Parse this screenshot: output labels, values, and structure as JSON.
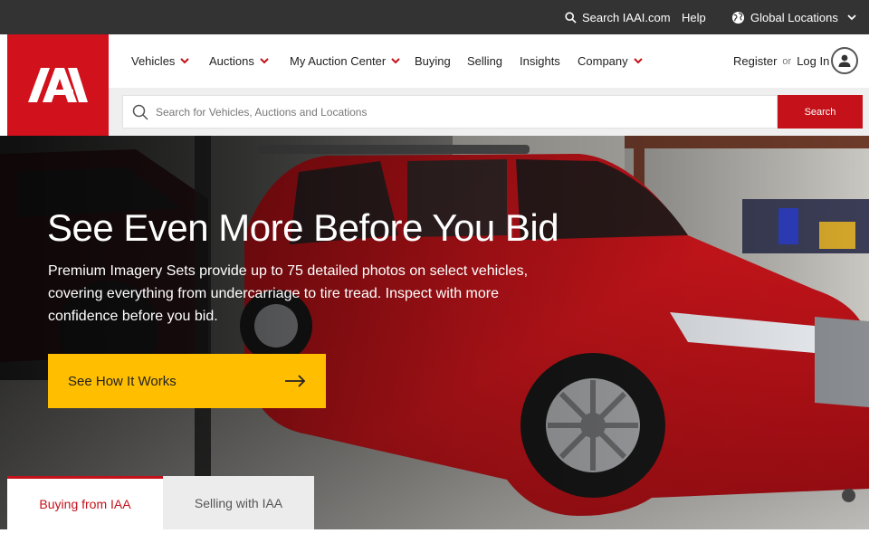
{
  "topbar": {
    "search_label": "Search IAAI.com",
    "help_label": "Help",
    "locations_label": "Global Locations"
  },
  "logo": {
    "alt": "IAA"
  },
  "nav": {
    "items": [
      {
        "label": "Vehicles",
        "has_dropdown": true
      },
      {
        "label": "Auctions",
        "has_dropdown": true
      },
      {
        "label": "My Auction Center",
        "has_dropdown": true
      },
      {
        "label": "Buying",
        "has_dropdown": false
      },
      {
        "label": "Selling",
        "has_dropdown": false
      },
      {
        "label": "Insights",
        "has_dropdown": false
      },
      {
        "label": "Company",
        "has_dropdown": true
      }
    ],
    "register_label": "Register",
    "or_label": "or",
    "login_label": "Log In"
  },
  "search": {
    "placeholder": "Search for Vehicles, Auctions and Locations",
    "button_label": "Search"
  },
  "hero": {
    "title": "See Even More Before You Bid",
    "text": "Premium Imagery Sets provide up to 75 detailed photos on select vehicles, covering everything from undercarriage to tire tread. Inspect with more confidence before you bid.",
    "cta_label": "See How It Works"
  },
  "tabs": [
    {
      "label": "Buying from IAA",
      "active": true
    },
    {
      "label": "Selling with IAA",
      "active": false
    }
  ],
  "colors": {
    "brand_red": "#d1111c",
    "cta_yellow": "#ffbe00",
    "topbar": "#333333"
  }
}
